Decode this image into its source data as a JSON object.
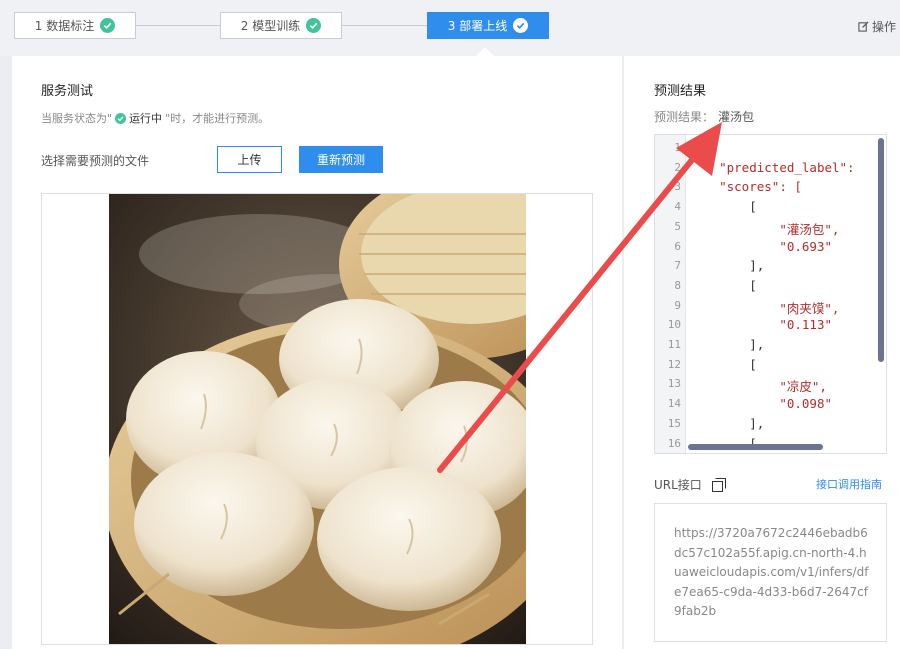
{
  "steps": [
    {
      "label": "1 数据标注"
    },
    {
      "label": "2 模型训练"
    },
    {
      "label": "3 部署上线"
    }
  ],
  "operation_link": "操作",
  "service_test": {
    "title": "服务测试",
    "hint_prefix": "当服务状态为\"",
    "hint_status": "运行中",
    "hint_suffix": "\"时，才能进行预测。",
    "file_label": "选择需要预测的文件",
    "upload_button": "上传",
    "repredict_button": "重新预测"
  },
  "prediction": {
    "title": "预测结果",
    "result_label": "预测结果：",
    "result_value": "灌汤包",
    "code_lines": [
      {
        "num": "1",
        "text": "{"
      },
      {
        "num": "2",
        "key": "\"predicted_label\":",
        "indent": "    "
      },
      {
        "num": "3",
        "key": "\"scores\": [",
        "indent": "    "
      },
      {
        "num": "4",
        "text": "[",
        "indent": "        "
      },
      {
        "num": "5",
        "str": "\"灌汤包\",",
        "indent": "            "
      },
      {
        "num": "6",
        "str": "\"0.693\"",
        "indent": "            "
      },
      {
        "num": "7",
        "text": "],",
        "indent": "        "
      },
      {
        "num": "8",
        "text": "[",
        "indent": "        "
      },
      {
        "num": "9",
        "str": "\"肉夹馍\",",
        "indent": "            "
      },
      {
        "num": "10",
        "str": "\"0.113\"",
        "indent": "            "
      },
      {
        "num": "11",
        "text": "],",
        "indent": "        "
      },
      {
        "num": "12",
        "text": "[",
        "indent": "        "
      },
      {
        "num": "13",
        "str": "\"凉皮\",",
        "indent": "            "
      },
      {
        "num": "14",
        "str": "\"0.098\"",
        "indent": "            "
      },
      {
        "num": "15",
        "text": "],",
        "indent": "        "
      },
      {
        "num": "16",
        "text": "[",
        "indent": "        "
      }
    ],
    "url_label": "URL接口",
    "api_guide_link": "接口调用指南",
    "url_value": "https://3720a7672c2446ebadb6dc57c102a55f.apig.cn-north-4.huaweicloudapis.com/v1/infers/dfe7ea65-c9da-4d33-b6d7-2647cf9fab2b"
  },
  "colors": {
    "accent": "#2e8ded",
    "success": "#41c39b",
    "annotation_arrow": "#ea4b4b"
  },
  "icons": [
    "check-icon",
    "edit-icon",
    "copy-icon"
  ]
}
